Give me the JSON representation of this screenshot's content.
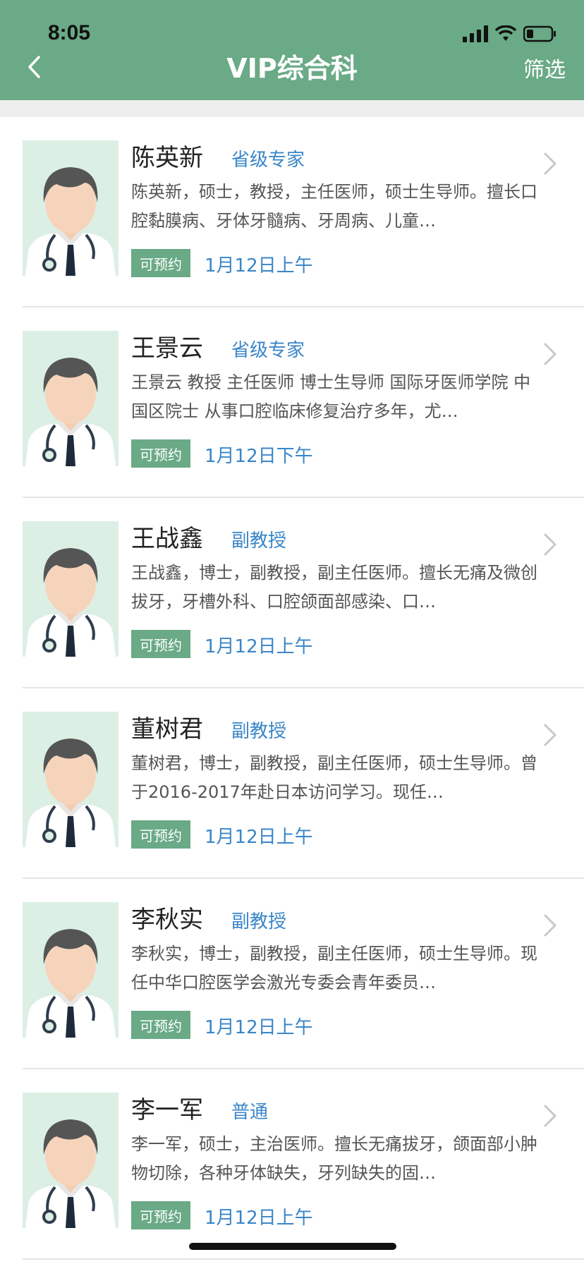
{
  "status_bar": {
    "time": "8:05"
  },
  "nav": {
    "title": "VIP综合科",
    "filter_label": "筛选"
  },
  "colors": {
    "header": "#6aaa86",
    "link": "#3a86c8",
    "badge": "#6aaa86"
  },
  "doctors": [
    {
      "name": "陈英新",
      "title": "省级专家",
      "description": "陈英新，硕士，教授，主任医师，硕士生导师。擅长口腔黏膜病、牙体牙髓病、牙周病、儿童…",
      "badge": "可预约",
      "slot": "1月12日上午"
    },
    {
      "name": "王景云",
      "title": "省级专家",
      "description": "王景云 教授 主任医师 博士生导师 国际牙医师学院 中国区院士 从事口腔临床修复治疗多年，尤…",
      "badge": "可预约",
      "slot": "1月12日下午"
    },
    {
      "name": "王战鑫",
      "title": "副教授",
      "description": "王战鑫，博士，副教授，副主任医师。擅长无痛及微创拔牙，牙槽外科、口腔颌面部感染、口…",
      "badge": "可预约",
      "slot": "1月12日上午"
    },
    {
      "name": "董树君",
      "title": "副教授",
      "description": "董树君，博士，副教授，副主任医师，硕士生导师。曾于2016-2017年赴日本访问学习。现任…",
      "badge": "可预约",
      "slot": "1月12日上午"
    },
    {
      "name": "李秋实",
      "title": "副教授",
      "description": "李秋实，博士，副教授，副主任医师，硕士生导师。现任中华口腔医学会激光专委会青年委员…",
      "badge": "可预约",
      "slot": "1月12日上午"
    },
    {
      "name": "李一军",
      "title": "普通",
      "description": "李一军，硕士，主治医师。擅长无痛拔牙，颌面部小肿物切除，各种牙体缺失，牙列缺失的固…",
      "badge": "可预约",
      "slot": "1月12日上午"
    }
  ]
}
